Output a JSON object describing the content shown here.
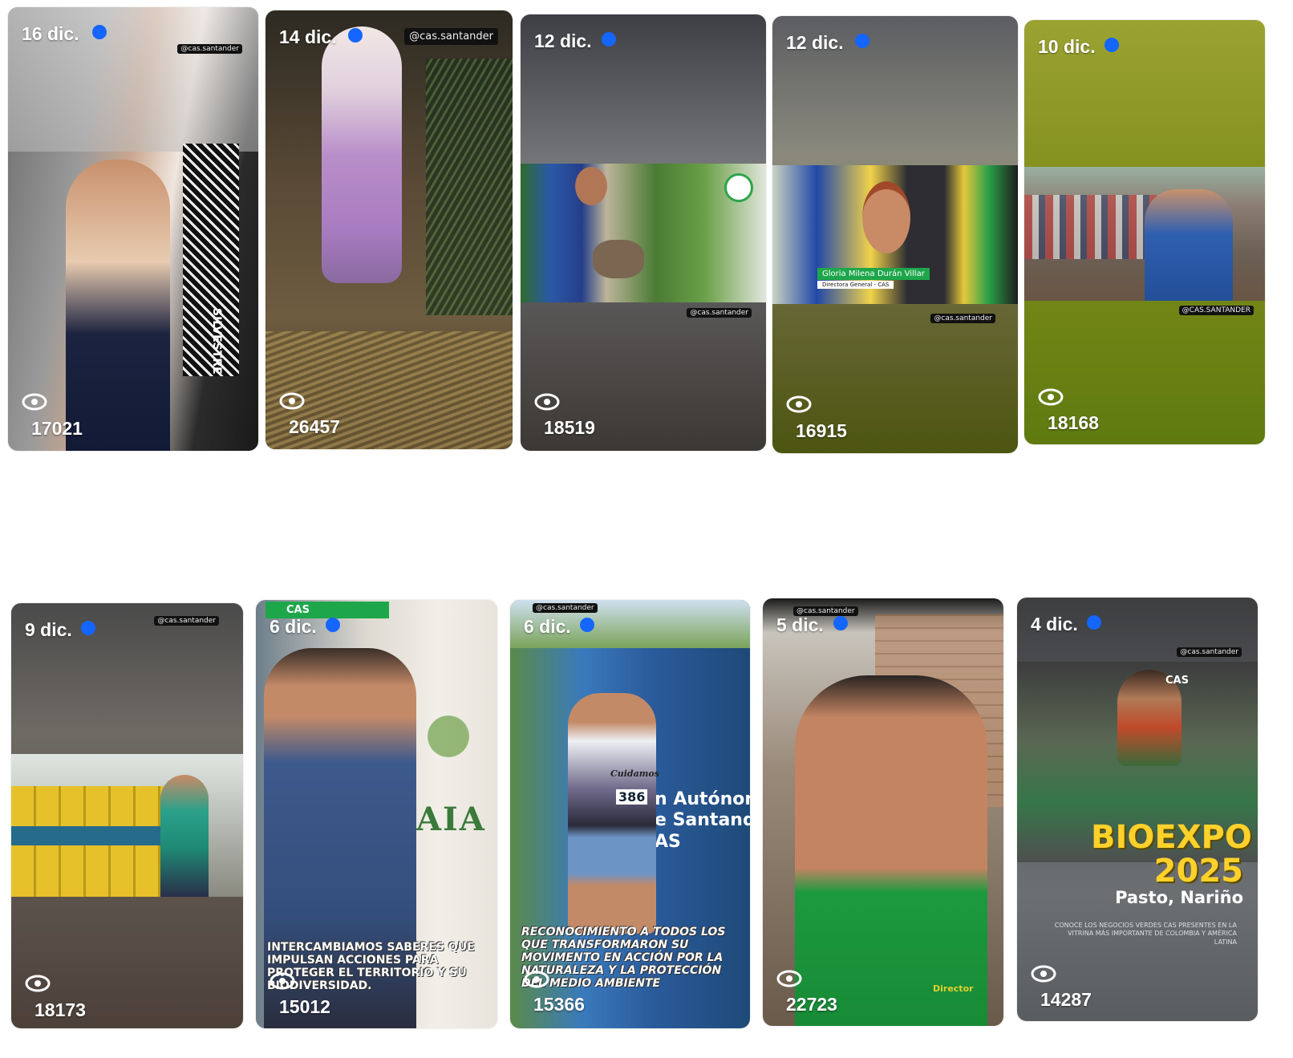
{
  "stories": [
    {
      "date": "16 dic.",
      "views": "17021",
      "watermark": "@cas.santander",
      "sign": "SILVESTRE"
    },
    {
      "date": "14 dic.",
      "views": "26457",
      "watermark": "@cas.santander"
    },
    {
      "date": "12 dic.",
      "views": "18519",
      "watermark": "@cas.santander"
    },
    {
      "date": "12 dic.",
      "views": "16915",
      "watermark": "@cas.santander",
      "lowerthird_name": "Gloria Milena Durán Villar",
      "lowerthird_role": "Directora General - CAS"
    },
    {
      "date": "10 dic.",
      "views": "18168",
      "watermark": "@CAS.SANTANDER"
    },
    {
      "date": "9 dic.",
      "views": "18173",
      "watermark": "@cas.santander"
    },
    {
      "date": "6 dic.",
      "views": "15012",
      "brand": "CAS",
      "caption": "INTERCAMBIAMOS SABERES QUE IMPULSAN ACCIONES PARA PROTEGER EL TERRITORIO Y SU BIODIVERSIDAD.",
      "logo_text": "AIA"
    },
    {
      "date": "6 dic.",
      "views": "15366",
      "watermark": "@cas.santander",
      "banner": "n Autónom\ne Santand\nAS",
      "bib": "386",
      "shirt": "Cuidamos",
      "caption": "RECONOCIMIENTO A TODOS LOS QUE TRANSFORMARON SU MOVIMENTO EN ACCIÓN POR LA NATURALEZA Y LA PROTECCIÓN DEL MEDIO AMBIENTE"
    },
    {
      "date": "5 dic.",
      "views": "22723",
      "watermark": "@cas.santander",
      "shirt": "Director"
    },
    {
      "date": "4 dic.",
      "views": "14287",
      "watermark": "@cas.santander",
      "brand": "CAS",
      "title": "BIOEXPO 2025",
      "subtitle": "Pasto, Nariño",
      "small": "CONOCE LOS NEGOCIOS VERDES CAS PRESENTES EN LA VITRINA MÁS IMPORTANTE DE COLOMBIA Y AMÉRICA LATINA"
    }
  ],
  "icons": {
    "views": "eye-icon",
    "unseen": "blue-dot-indicator"
  },
  "colors": {
    "dot": "#1565ff",
    "brand_green": "#1ea64a",
    "title_yellow": "#ffd12a"
  }
}
